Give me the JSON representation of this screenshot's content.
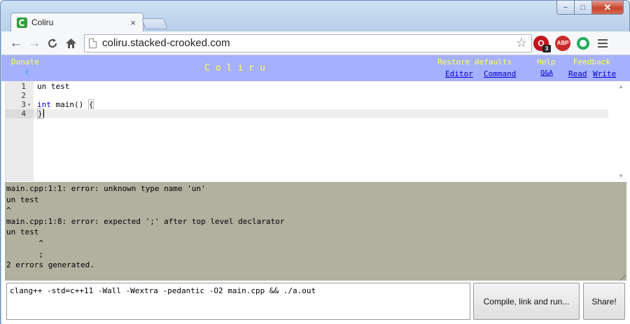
{
  "window": {
    "controls": {
      "minimize": "−",
      "maximize": "□",
      "close": "✕"
    }
  },
  "tab": {
    "title": "Coliru",
    "close": "×",
    "favicon": "coliru-c-icon"
  },
  "toolbar": {
    "back": "←",
    "forward": "→",
    "reload": "C",
    "home": "⌂",
    "url": "coliru.stacked-crooked.com",
    "star": "☆",
    "extensions": [
      {
        "name": "opera-ext-icon",
        "badge": "3"
      },
      {
        "name": "adblock-icon",
        "label": "ABP"
      },
      {
        "name": "green-ring-icon",
        "label": ""
      }
    ]
  },
  "header": {
    "donate": "Donate",
    "euro": "€",
    "brand": "Coliru",
    "restore": "Restore defaults",
    "editor": "Editor",
    "command": "Command",
    "help": "Help",
    "qa": "Q&A",
    "feedback": "Feedback",
    "read": "Read",
    "write": "Write"
  },
  "editor": {
    "lines": [
      {
        "num": "1",
        "text": "un test"
      },
      {
        "num": "2",
        "text": ""
      },
      {
        "num": "3",
        "text": "int main() {"
      },
      {
        "num": "4",
        "text": "}"
      }
    ]
  },
  "output": {
    "text": "main.cpp:1:1: error: unknown type name 'un'\nun test\n^\nmain.cpp:1:8: error: expected ';' after top level declarator\nun test\n       ^\n       ;\n2 errors generated."
  },
  "command": {
    "value": "clang++ -std=c++11 -Wall -Wextra -pedantic -O2 main.cpp && ./a.out",
    "compile_label": "Compile, link and run...",
    "share_label": "Share!"
  }
}
